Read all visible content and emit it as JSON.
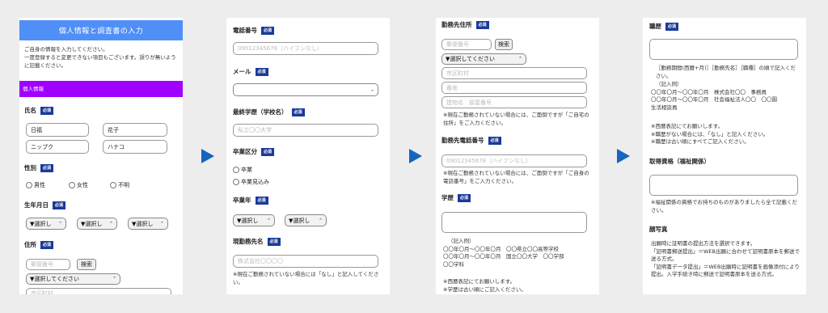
{
  "panel1": {
    "header": "個人情報と調査書の入力",
    "intro": [
      "ご自身の情報を入力してください。",
      "一度登録すると変更できない項目もございます。誤りが無いように記載ください。"
    ],
    "section_bar": "個人情報",
    "name_label": "氏名",
    "required": "必須",
    "last_name": "日福",
    "first_name": "花子",
    "last_name_kana": "ニップク",
    "first_name_kana": "ハナコ",
    "gender_label": "性別",
    "gender_options": [
      "男性",
      "女性",
      "不明"
    ],
    "dob_label": "生年月日",
    "dob_select": "▼選択し",
    "address_label": "住所",
    "postal_placeholder": "郵便番号",
    "search_button": "検索",
    "pref_select": "▼選択してください",
    "city_placeholder": "市区町村"
  },
  "panel2": {
    "phone_label": "電話番号",
    "phone_placeholder": "09012345678（ハイフンなし）",
    "mail_label": "メール",
    "school_label": "最終学歴（学校名）",
    "school_placeholder": "私立〇〇大学",
    "grad_label": "卒業区分",
    "grad_options": [
      "卒業",
      "卒業見込み"
    ],
    "grad_year_label": "卒業年",
    "year_select": "▼選択し",
    "employer_label": "現勤務先名",
    "employer_placeholder": "株式会社〇〇〇〇",
    "employer_note": "※現在ご勤務されていない場合には「なし」と記入してください。"
  },
  "panel3": {
    "work_address_label": "勤務先住所",
    "postal_placeholder": "郵便番号",
    "search_button": "検索",
    "pref_select": "▼選択してください",
    "city_placeholder": "市区町村",
    "street_placeholder": "番地",
    "building_placeholder": "建物名　部屋番号",
    "address_note": "※現在ご勤務されていない場合には、ご面倒ですが「ご自宅の住所」をご入力ください。",
    "work_phone_label": "勤務先電話番号",
    "work_phone_placeholder": "09012345678（ハイフンなし）",
    "phone_note": "※現在ご勤務されていない場合には、ご面倒ですが「ご自身の電話番号」をご入力ください。",
    "education_label": "学歴",
    "example_title": "（記入例）",
    "example_lines": [
      "〇〇年〇月～〇〇年〇月　〇〇県立〇〇高等学校",
      "〇〇年〇月～〇〇年〇月　国立〇〇大学　〇〇学部",
      "〇〇学科"
    ],
    "edu_notes": [
      "※西暦表記にてお願いします。",
      "※学歴は古い順にご記入ください。"
    ]
  },
  "panel4": {
    "career_label": "職歴",
    "career_format": "［勤務期間(西暦+月)］［勤務先名］［職種］の順で記入ください。",
    "example_title": "（記入例）",
    "example_lines": [
      "〇〇年〇月～〇〇年〇月　株式会社〇〇　事務員",
      "〇〇年〇月～〇〇年〇月　社会福祉法人〇〇　〇〇園",
      "生活相談員"
    ],
    "career_notes": [
      "※西暦表記にてお願いします。",
      "※職歴がない場合には、「なし」と記入ください。",
      "※職歴は古い順にすべてご記入ください。"
    ],
    "qual_label": "取得資格（福祉関係）",
    "qual_note": "※福祉関係の資格でお持ちのものがありましたら全て記載ください。",
    "photo_label": "顔写真",
    "photo_text": [
      "出願時に証明書の提出方法を選択できます。",
      "「証明書郵送提出」＝WEB出願に合わせて証明書原本を郵送で送る方式。",
      "「証明書データ提出」＝WEB出願時に証明書を画像添付により提出。入学手続き時に郵送で証明書原本を送る方式。"
    ]
  }
}
